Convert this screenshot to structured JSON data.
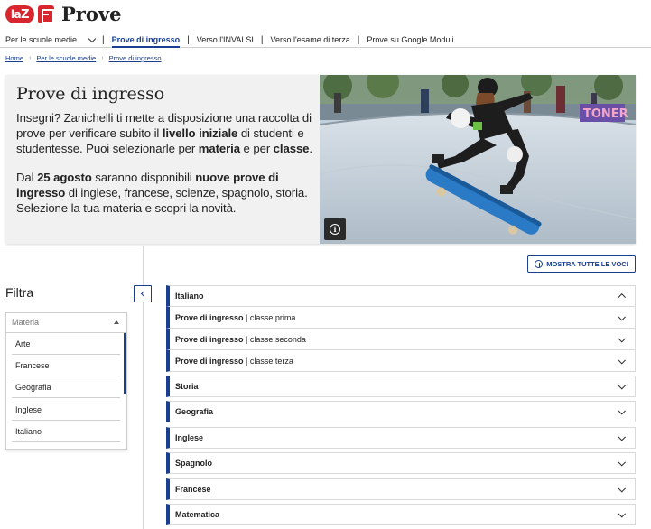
{
  "logo": {
    "badge": "la",
    "badge2": "Z",
    "title": "Prove"
  },
  "nav": {
    "items": [
      {
        "label": "Per le scuole medie",
        "active": false
      },
      {
        "label": "Prove di ingresso",
        "active": true
      },
      {
        "label": "Verso l'INVALSI",
        "active": false
      },
      {
        "label": "Verso l'esame di terza",
        "active": false
      },
      {
        "label": "Prove su Google Moduli",
        "active": false
      }
    ],
    "separator": "|"
  },
  "breadcrumb": [
    "Home",
    "Per le scuole medie",
    "Prove di ingresso"
  ],
  "hero": {
    "title": "Prove di ingresso",
    "p1": {
      "a": "Insegni? Zanichelli ti mette a disposizione una raccolta di prove per verificare subito il ",
      "b": "livello iniziale",
      "c": " di studenti e studentesse. Puoi selezionarle per ",
      "d": "materia",
      "e": " e per ",
      "f": "classe",
      "g": "."
    },
    "p2": {
      "a": "Dal ",
      "b": "25 agosto",
      "c": " saranno disponibili ",
      "d": "nuove prove di ingresso",
      "e": " di inglese, francese, scienze, spagnolo, storia. Selezione la tua materia e scopri la novità."
    },
    "image_caption_text": "TONER",
    "info_icon": "info-icon"
  },
  "filter": {
    "title": "Filtra",
    "select_placeholder": "Materia",
    "options": [
      "Arte",
      "Francese",
      "Geografia",
      "Inglese",
      "Italiano"
    ]
  },
  "main": {
    "show_all_label": "MOSTRA TUTTE LE VOCI",
    "accordion": [
      {
        "label": "Italiano",
        "expanded": true
      },
      {
        "bold": "Prove di ingresso",
        "sep": " | ",
        "sub": "classe prima"
      },
      {
        "bold": "Prove di ingresso",
        "sep": " | ",
        "sub": "classe seconda"
      },
      {
        "bold": "Prove di ingresso",
        "sep": " | ",
        "sub": "classe terza"
      },
      {
        "label": "Storia"
      },
      {
        "label": "Geografia"
      },
      {
        "label": "Inglese"
      },
      {
        "label": "Spagnolo"
      },
      {
        "label": "Francese"
      },
      {
        "label": "Matematica"
      }
    ]
  },
  "colors": {
    "brand_red": "#d7262d",
    "accent_blue": "#1a3f8f"
  }
}
